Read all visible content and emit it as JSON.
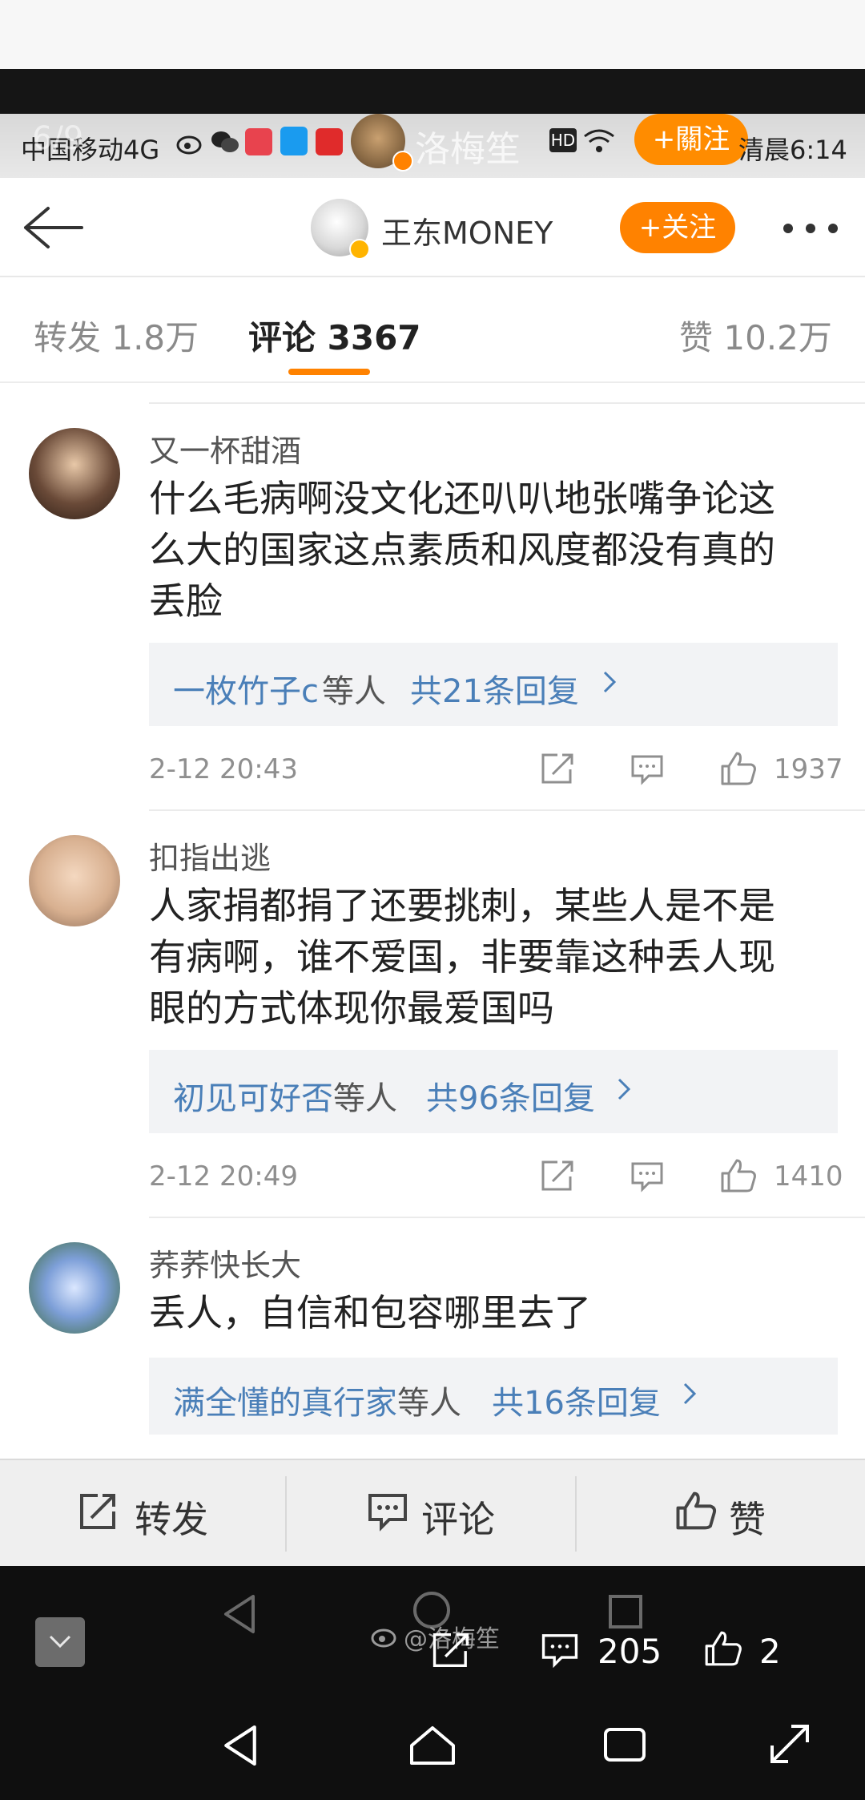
{
  "viewer": {
    "page_counter": "6/9",
    "watermark": "@洛梅笙",
    "comment_count": "205",
    "like_count": "2"
  },
  "status_bar": {
    "carrier": "中国移动4G",
    "username": "洛梅笙",
    "follow_label": "+關注",
    "time_text": "清晨6:14"
  },
  "header": {
    "author": "王东MONEY",
    "follow_label": "+关注"
  },
  "tabs": {
    "repost": "转发 1.8万",
    "comments": "评论 3367",
    "likes": "赞 10.2万"
  },
  "comments": [
    {
      "name": "又一杯甜酒",
      "body": "什么毛病啊没文化还叭叭地张嘴争论这么大的国家这点素质和风度都没有真的丢脸",
      "reply_names": "一枚竹子c",
      "reply_mid": "等人",
      "reply_count": "共21条回复",
      "time": "2-12 20:43",
      "likes": "1937"
    },
    {
      "name": "扣指出逃",
      "body": "人家捐都捐了还要挑刺，某些人是不是有病啊，谁不爱国，非要靠这种丢人现眼的方式体现你最爱国吗",
      "reply_names": "初见可好否",
      "reply_mid": "等人",
      "reply_count": "共96条回复",
      "time": "2-12 20:49",
      "likes": "1410"
    },
    {
      "name": "荞荞快长大",
      "body": "丢人，自信和包容哪里去了",
      "reply_names": "满全懂的真行家",
      "reply_mid": "等人",
      "reply_count": "共16条回复"
    }
  ],
  "action_bar": {
    "repost": "转发",
    "comment": "评论",
    "like": "赞"
  },
  "colors": {
    "accent": "#ff8200",
    "link": "#4a7fb8"
  }
}
